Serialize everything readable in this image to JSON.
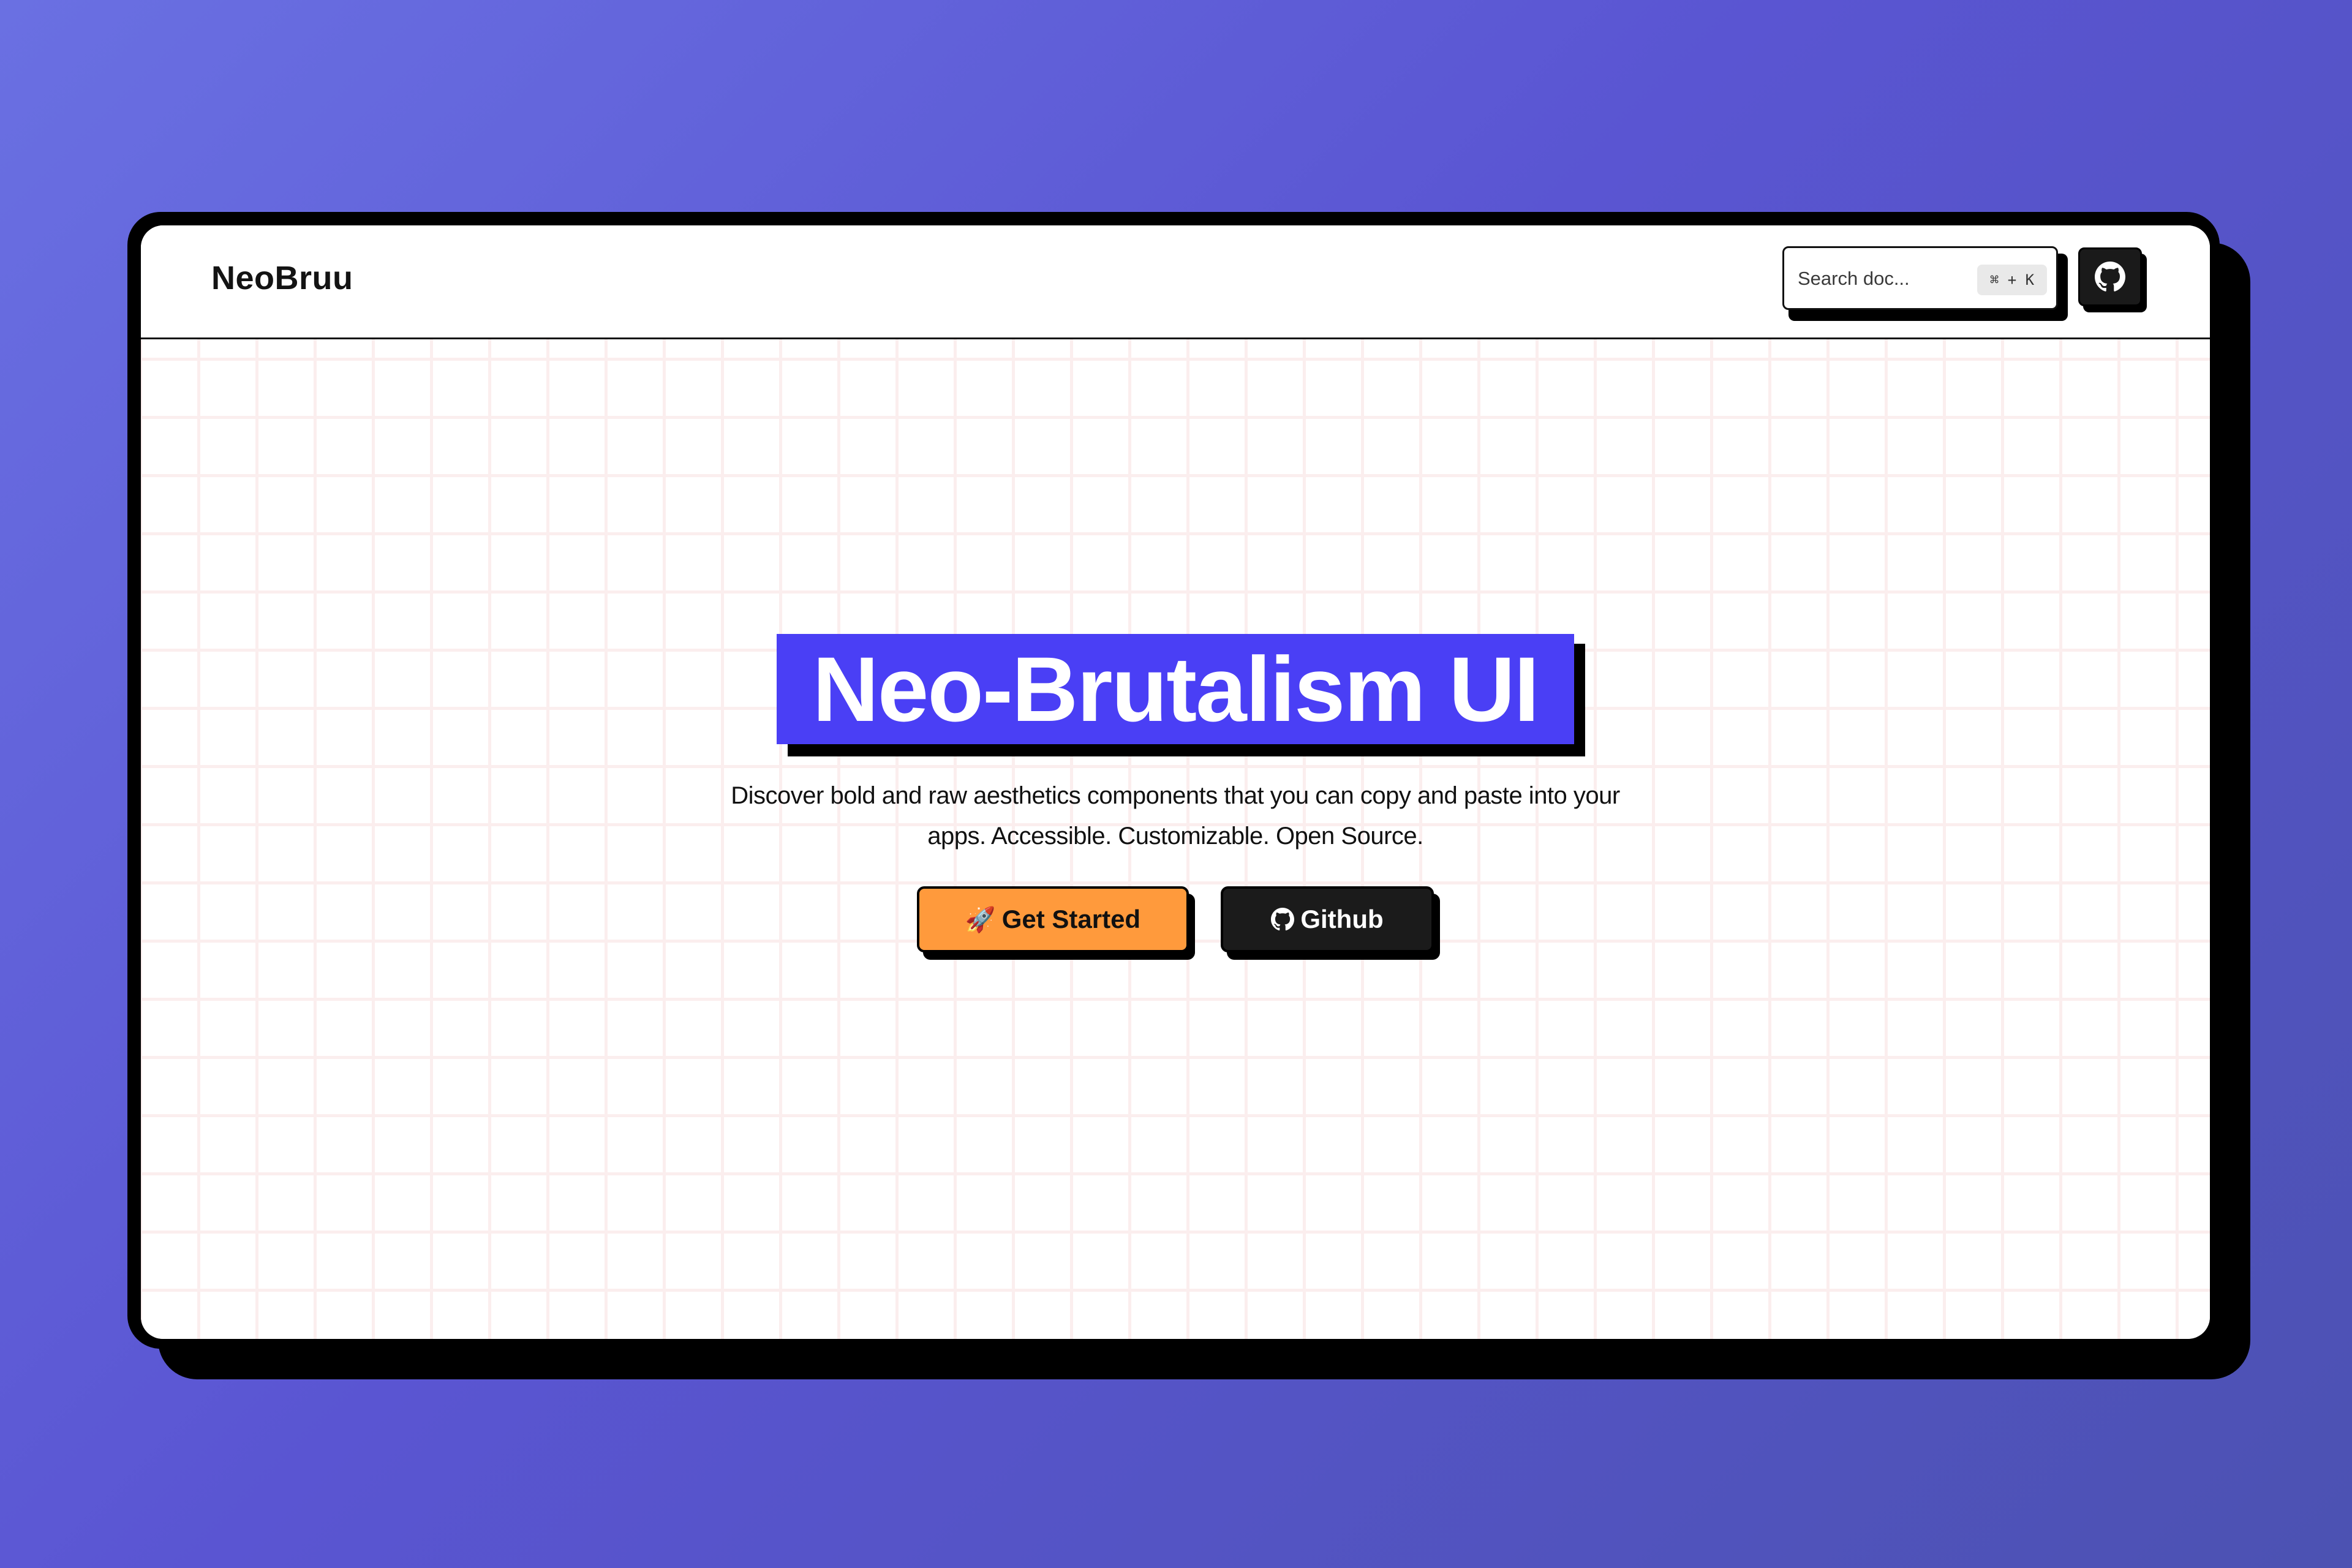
{
  "app": {
    "logo": "NeoBruu"
  },
  "header": {
    "search": {
      "placeholder": "Search doc...",
      "shortcut": "⌘ + K"
    },
    "github_icon": "github-icon"
  },
  "hero": {
    "title": "Neo-Brutalism UI",
    "subtitle_line1": "Discover bold and raw aesthetics components that you can copy and paste into your",
    "subtitle_line2": "apps. Accessible. Customizable. Open Source.",
    "primary_button": {
      "icon": "🚀",
      "label": "Get Started"
    },
    "secondary_button": {
      "icon": "github-icon",
      "label": "Github"
    }
  },
  "colors": {
    "background_gradient_start": "#6a70e2",
    "background_gradient_end": "#4c52b2",
    "title_highlight": "#4a3ff5",
    "primary_button": "#ff9a3c",
    "secondary_button": "#1b1b1b",
    "grid_line": "#fbeeee"
  }
}
